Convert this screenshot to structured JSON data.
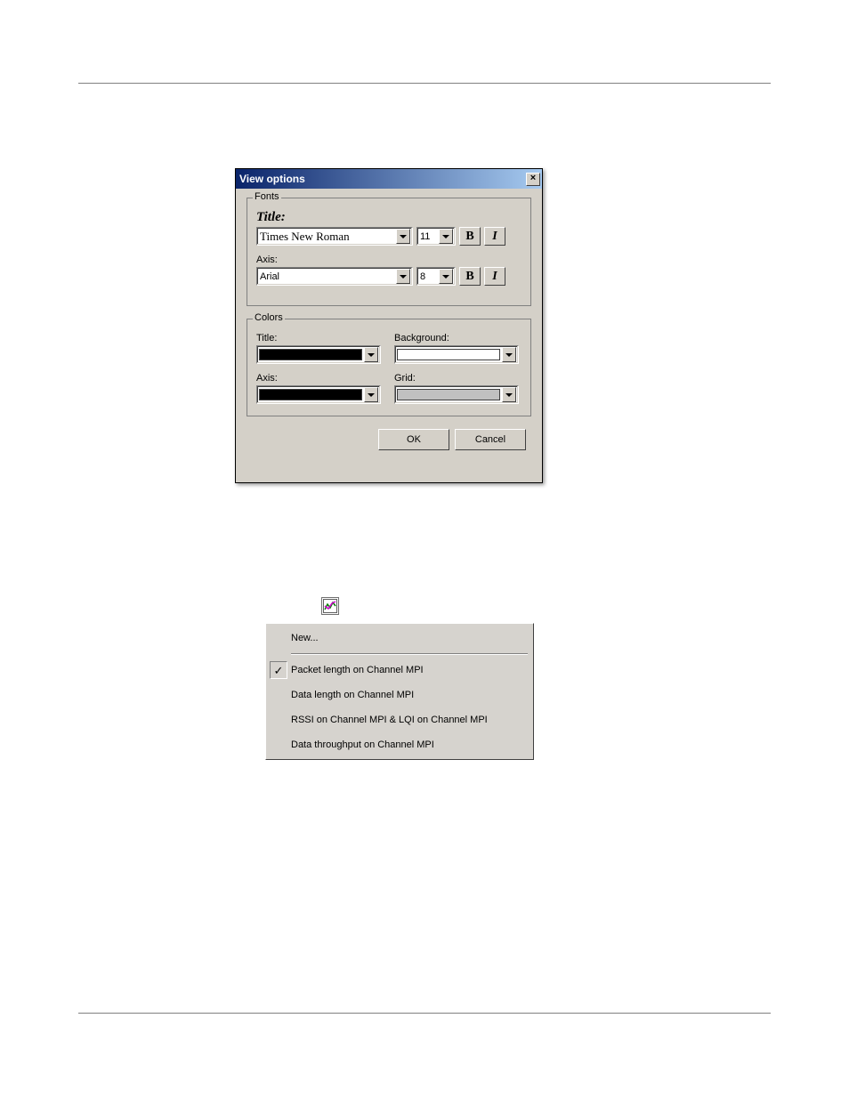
{
  "dialog": {
    "title": "View options",
    "close_glyph": "×",
    "fonts": {
      "legend": "Fonts",
      "title_label": "Title:",
      "title_font": "Times New Roman",
      "title_size": "11",
      "axis_label": "Axis:",
      "axis_font": "Arial",
      "axis_size": "8",
      "bold_glyph": "B",
      "italic_glyph": "I"
    },
    "colors": {
      "legend": "Colors",
      "title_label": "Title:",
      "title_color": "#000000",
      "background_label": "Background:",
      "background_color": "#ffffff",
      "axis_label": "Axis:",
      "axis_color": "#000000",
      "grid_label": "Grid:",
      "grid_color": "#c0c0c0"
    },
    "buttons": {
      "ok": "OK",
      "cancel": "Cancel"
    }
  },
  "menu": {
    "new_label": "New...",
    "items": [
      {
        "checked": true,
        "label": "Packet length on Channel MPI"
      },
      {
        "checked": false,
        "label": "Data length on Channel MPI"
      },
      {
        "checked": false,
        "label": "RSSI on Channel MPI & LQI on Channel MPI"
      },
      {
        "checked": false,
        "label": "Data throughput on Channel MPI"
      }
    ],
    "check_glyph": "✓"
  }
}
